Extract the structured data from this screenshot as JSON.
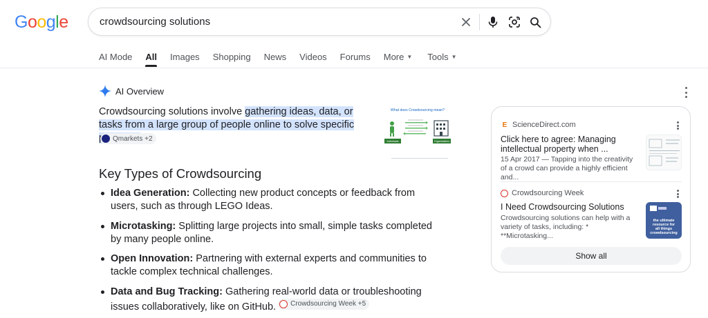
{
  "logo": {
    "letters": [
      "G",
      "o",
      "o",
      "g",
      "l",
      "e"
    ],
    "colors": [
      "#4285F4",
      "#EA4335",
      "#FBBC05",
      "#4285F4",
      "#34A853",
      "#EA4335"
    ]
  },
  "search": {
    "query": "crowdsourcing solutions"
  },
  "tabs": [
    {
      "label": "AI Mode"
    },
    {
      "label": "All",
      "active": true
    },
    {
      "label": "Images"
    },
    {
      "label": "Shopping"
    },
    {
      "label": "News"
    },
    {
      "label": "Videos"
    },
    {
      "label": "Forums"
    },
    {
      "label": "More",
      "dropdown": true
    },
    {
      "label": "Tools",
      "dropdown": true
    }
  ],
  "ai_overview": {
    "title": "AI Overview",
    "summary_prefix": "Crowdsourcing solutions involve ",
    "summary_highlight": "gathering ideas, data, or tasks from a large group of people online to solve specific problems",
    "summary_suffix": ".",
    "source_chip": "Qmarkets +2",
    "image": {
      "title": "What does Crowdsourcing mean?",
      "left_label": "Individuals",
      "right_label": "Organizations"
    },
    "section_title": "Key Types of Crowdsourcing",
    "items": [
      {
        "term": "Idea Generation:",
        "text": " Collecting new product concepts or feedback from users, such as through LEGO Ideas."
      },
      {
        "term": "Microtasking:",
        "text": " Splitting large projects into small, simple tasks completed by many people online."
      },
      {
        "term": "Open Innovation:",
        "text": " Partnering with external experts and communities to tackle complex technical challenges."
      },
      {
        "term": "Data and Bug Tracking:",
        "text": " Gathering real-world data or troubleshooting issues collaboratively, like on GitHub.",
        "chip": "Crowdsourcing Week +5"
      }
    ]
  },
  "side_card": {
    "sources": [
      {
        "site": "ScienceDirect.com",
        "title": "Click here to agree: Managing intellectual property when ...",
        "snippet": "15 Apr 2017 — Tapping into the creativity of a crowd can provide a highly efficient and..."
      },
      {
        "site": "Crowdsourcing Week",
        "title": "I Need Crowdsourcing Solutions",
        "snippet": "Crowdsourcing solutions can help with a variety of tasks, including: * **Microtasking...",
        "thumb_text": "the ultimate resource for all things crowdsourcing"
      }
    ],
    "show_all": "Show all"
  },
  "colors": {
    "highlight": "#d3e3fd",
    "chip_bg": "#f1f3f4",
    "accent_blue": "#1a73e8"
  }
}
